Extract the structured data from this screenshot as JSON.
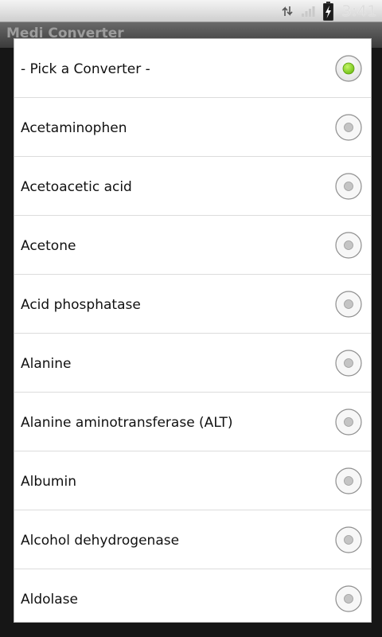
{
  "status_bar": {
    "clock": "3:41",
    "icons": [
      "sync-icon",
      "signal-icon",
      "battery-charging-icon"
    ]
  },
  "app": {
    "title": "Medi Converter"
  },
  "dialog": {
    "selected_index": 0,
    "accent_color": "#8cd21e",
    "options": [
      {
        "label": "- Pick a Converter -",
        "checked": true
      },
      {
        "label": "Acetaminophen",
        "checked": false
      },
      {
        "label": "Acetoacetic acid",
        "checked": false
      },
      {
        "label": "Acetone",
        "checked": false
      },
      {
        "label": "Acid phosphatase",
        "checked": false
      },
      {
        "label": "Alanine",
        "checked": false
      },
      {
        "label": "Alanine aminotransferase (ALT)",
        "checked": false
      },
      {
        "label": "Albumin",
        "checked": false
      },
      {
        "label": "Alcohol dehydrogenase",
        "checked": false
      },
      {
        "label": "Aldolase",
        "checked": false
      }
    ]
  }
}
